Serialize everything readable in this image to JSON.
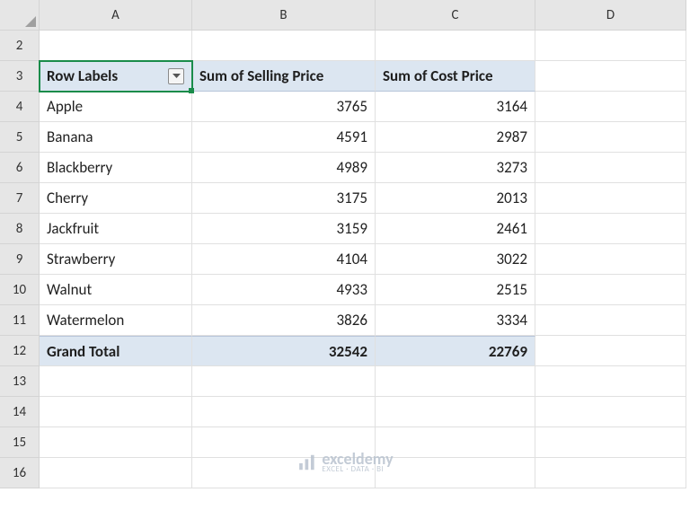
{
  "columns": [
    "A",
    "B",
    "C",
    "D"
  ],
  "visibleRowStart": 2,
  "visibleRowEnd": 16,
  "pivot": {
    "headerRow": 3,
    "headers": {
      "rowLabels": "Row Labels",
      "col1": "Sum of Selling Price",
      "col2": "Sum of Cost Price"
    },
    "data": [
      {
        "label": "Apple",
        "selling": "3765",
        "cost": "3164"
      },
      {
        "label": "Banana",
        "selling": "4591",
        "cost": "2987"
      },
      {
        "label": "Blackberry",
        "selling": "4989",
        "cost": "3273"
      },
      {
        "label": "Cherry",
        "selling": "3175",
        "cost": "2013"
      },
      {
        "label": "Jackfruit",
        "selling": "3159",
        "cost": "2461"
      },
      {
        "label": "Strawberry",
        "selling": "4104",
        "cost": "3022"
      },
      {
        "label": "Walnut",
        "selling": "4933",
        "cost": "2515"
      },
      {
        "label": "Watermelon",
        "selling": "3826",
        "cost": "3334"
      }
    ],
    "totalRow": 12,
    "total": {
      "label": "Grand Total",
      "selling": "32542",
      "cost": "22769"
    }
  },
  "selectedCell": "A3",
  "watermark": {
    "brand": "exceldemy",
    "tagline": "EXCEL · DATA · BI"
  }
}
